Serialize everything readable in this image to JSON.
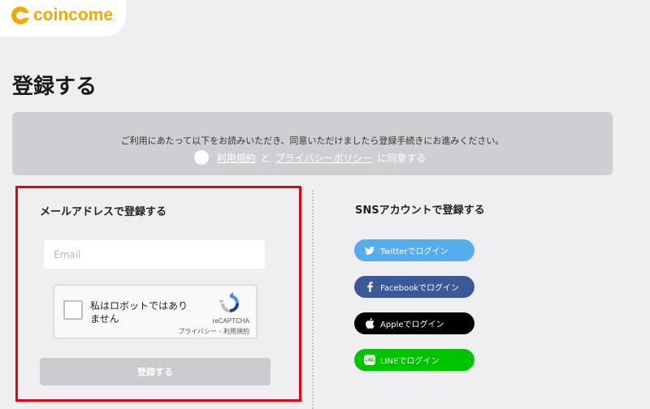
{
  "header": {
    "logo_text": "coincome",
    "logo_suffix": "."
  },
  "page": {
    "title": "登録する"
  },
  "consent": {
    "message": "ご利用にあたって以下をお読みいただき、同意いただけましたら登録手続きにお進みください。",
    "terms_link": "利用規約",
    "and": "と",
    "privacy_link": "プライバシーポリシー",
    "agree_suffix": "に同意する"
  },
  "email_section": {
    "title": "メールアドレスで登録する",
    "email_placeholder": "Email",
    "recaptcha": {
      "label": "私はロボットではありません",
      "brand": "reCAPTCHA",
      "links": "プライバシー - 利用規約"
    },
    "submit_label": "登録する"
  },
  "sns_section": {
    "title": "SNSアカウントで登録する",
    "buttons": [
      {
        "label": "Twitterでログイン",
        "icon": "twitter-icon",
        "color": "#55acee"
      },
      {
        "label": "Facebookでログイン",
        "icon": "facebook-icon",
        "color": "#3b5998"
      },
      {
        "label": "Appleでログイン",
        "icon": "apple-icon",
        "color": "#000000"
      },
      {
        "label": "LINEでログイン",
        "icon": "line-icon",
        "color": "#00c300",
        "badge": "LINE"
      }
    ]
  },
  "colors": {
    "brand": "#f5a800",
    "highlight_border": "#e60012",
    "background": "#efeff1"
  }
}
